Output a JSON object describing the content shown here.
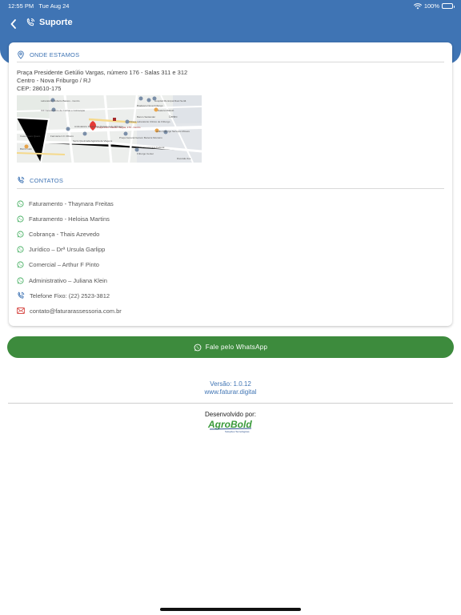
{
  "status_bar": {
    "time": "12:55 PM",
    "date": "Tue Aug 24",
    "battery": "100%"
  },
  "nav": {
    "title": "Suporte"
  },
  "location": {
    "heading": "ONDE ESTAMOS",
    "address_line1": "Praça Presidente Getúlio Vargas, número 176 - Salas 311 e 312",
    "address_line2": "Centro - Nova Friburgo / RJ",
    "cep": "CEP: 28610-175",
    "map_labels": [
      "Laboratório Roberto Bastos - Centro",
      "ICF Faturamento de Contas e Cobranças",
      "Casa Quero Quero",
      "Farmácia C.F. Ribeiro",
      "Praça Pres. Getúlio Vargas, 176 - Centro",
      "Clínica Laboratório Clínico de Friburgo",
      "Serra Queimada Agência de Viagens",
      "Bistrô Café",
      "Friburgo Center",
      "Praça General Gerson Bezerra Monteiro",
      "Hidro Friburgo Serviços Móveis",
      "Bradesco Nova Friburgo",
      "Centro",
      "Banco Santander",
      "Hospital Municipal Raul Sertã",
      "Galeria Maktub",
      "Caixa Econômica Federal",
      "Diversão Ilus",
      "Ambulatório Psiquiatria Prefeitura de Friburgo"
    ]
  },
  "contacts": {
    "heading": "CONTATOS",
    "items": [
      {
        "label": "Faturamento - Thaynara Freitas",
        "icon": "whatsapp-icon"
      },
      {
        "label": "Faturamento - Heloisa Martins",
        "icon": "whatsapp-icon"
      },
      {
        "label": "Cobrança - Thais Azevedo",
        "icon": "whatsapp-icon"
      },
      {
        "label": "Jurídico – Drª Ursula Garlipp",
        "icon": "whatsapp-icon"
      },
      {
        "label": "Comercial – Arthur F Pinto",
        "icon": "whatsapp-icon"
      },
      {
        "label": "Administrativo – Juliana Klein",
        "icon": "whatsapp-icon"
      },
      {
        "label": "Telefone Fixo: (22) 2523-3812",
        "icon": "phone-icon"
      },
      {
        "label": "contato@faturarassessoria.com.br",
        "icon": "mail-icon"
      }
    ]
  },
  "whatsapp_button": {
    "label": "Fale pelo WhatsApp"
  },
  "footer": {
    "version": "Versão: 1.0.12",
    "site": "www.faturar.digital",
    "developed_by": "Desenvolvido por:",
    "logo_text": "AgroBold",
    "logo_tagline": "Soluções Tecnológicas"
  },
  "colors": {
    "primary": "#3f74b4",
    "whatsapp_green": "#3d8b3d",
    "mail_red": "#d9534f",
    "icon_green": "#34a853"
  }
}
